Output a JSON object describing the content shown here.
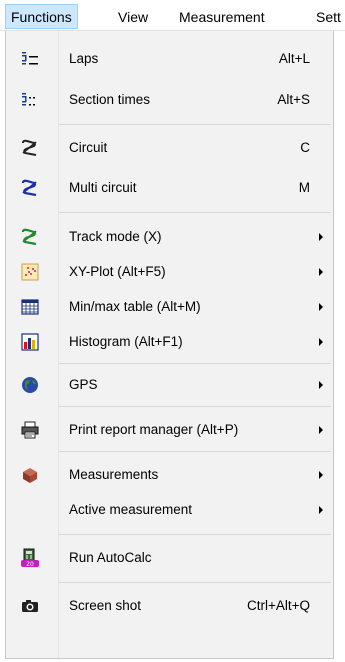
{
  "menubar": {
    "items": [
      {
        "label": "Functions"
      },
      {
        "label": "View"
      },
      {
        "label": "Measurement"
      },
      {
        "label": "Sett"
      }
    ]
  },
  "menu": {
    "items": [
      {
        "label": "Laps",
        "shortcut": "Alt+L",
        "icon": "laps-icon"
      },
      {
        "label": "Section times",
        "shortcut": "Alt+S",
        "icon": "section-times-icon"
      },
      {
        "label": "Circuit",
        "shortcut": "C",
        "icon": "circuit-icon"
      },
      {
        "label": "Multi circuit",
        "shortcut": "M",
        "icon": "multi-circuit-icon"
      },
      {
        "label": "Track mode (X)",
        "icon": "track-mode-icon"
      },
      {
        "label": "XY-Plot (Alt+F5)",
        "icon": "xy-plot-icon"
      },
      {
        "label": "Min/max table (Alt+M)",
        "icon": "table-icon"
      },
      {
        "label": "Histogram (Alt+F1)",
        "icon": "histogram-icon"
      },
      {
        "label": "GPS",
        "icon": "globe-icon"
      },
      {
        "label": "Print report manager (Alt+P)",
        "icon": "printer-icon"
      },
      {
        "label": "Measurements",
        "icon": "box-icon"
      },
      {
        "label": "Active measurement"
      },
      {
        "label": "Run AutoCalc",
        "icon": "autocalc-icon"
      },
      {
        "label": "Screen shot",
        "shortcut": "Ctrl+Alt+Q",
        "icon": "camera-icon"
      }
    ]
  }
}
